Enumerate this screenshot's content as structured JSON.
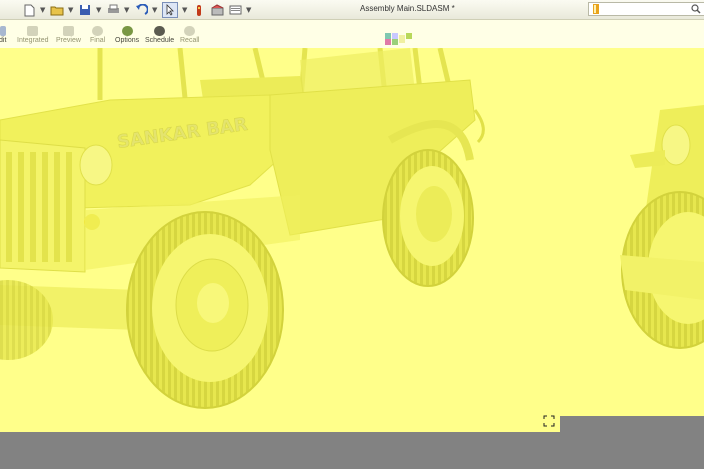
{
  "titlebar": {
    "title": "Assembly Main.SLDASM *",
    "icons": [
      "new-document-icon",
      "open-folder-icon",
      "save-icon",
      "print-icon",
      "undo-icon",
      "select-arrow-icon",
      "rebuild-icon",
      "options-icon",
      "view-icon"
    ]
  },
  "ribbon": {
    "buttons": [
      {
        "label": "dit",
        "state": "active"
      },
      {
        "label": "Integrated",
        "state": "disabled"
      },
      {
        "label": "Preview",
        "state": "disabled"
      },
      {
        "label": "Final",
        "state": "disabled"
      },
      {
        "label": "Options",
        "state": "active"
      },
      {
        "label": "Schedule",
        "state": "active"
      },
      {
        "label": "Recall",
        "state": "disabled"
      }
    ]
  },
  "model": {
    "hood_text": "SANKAR BAR"
  },
  "colors": {
    "viewport_bg": "#ffff8a",
    "model_body": "#f2f25e",
    "status_gray": "#828282"
  }
}
